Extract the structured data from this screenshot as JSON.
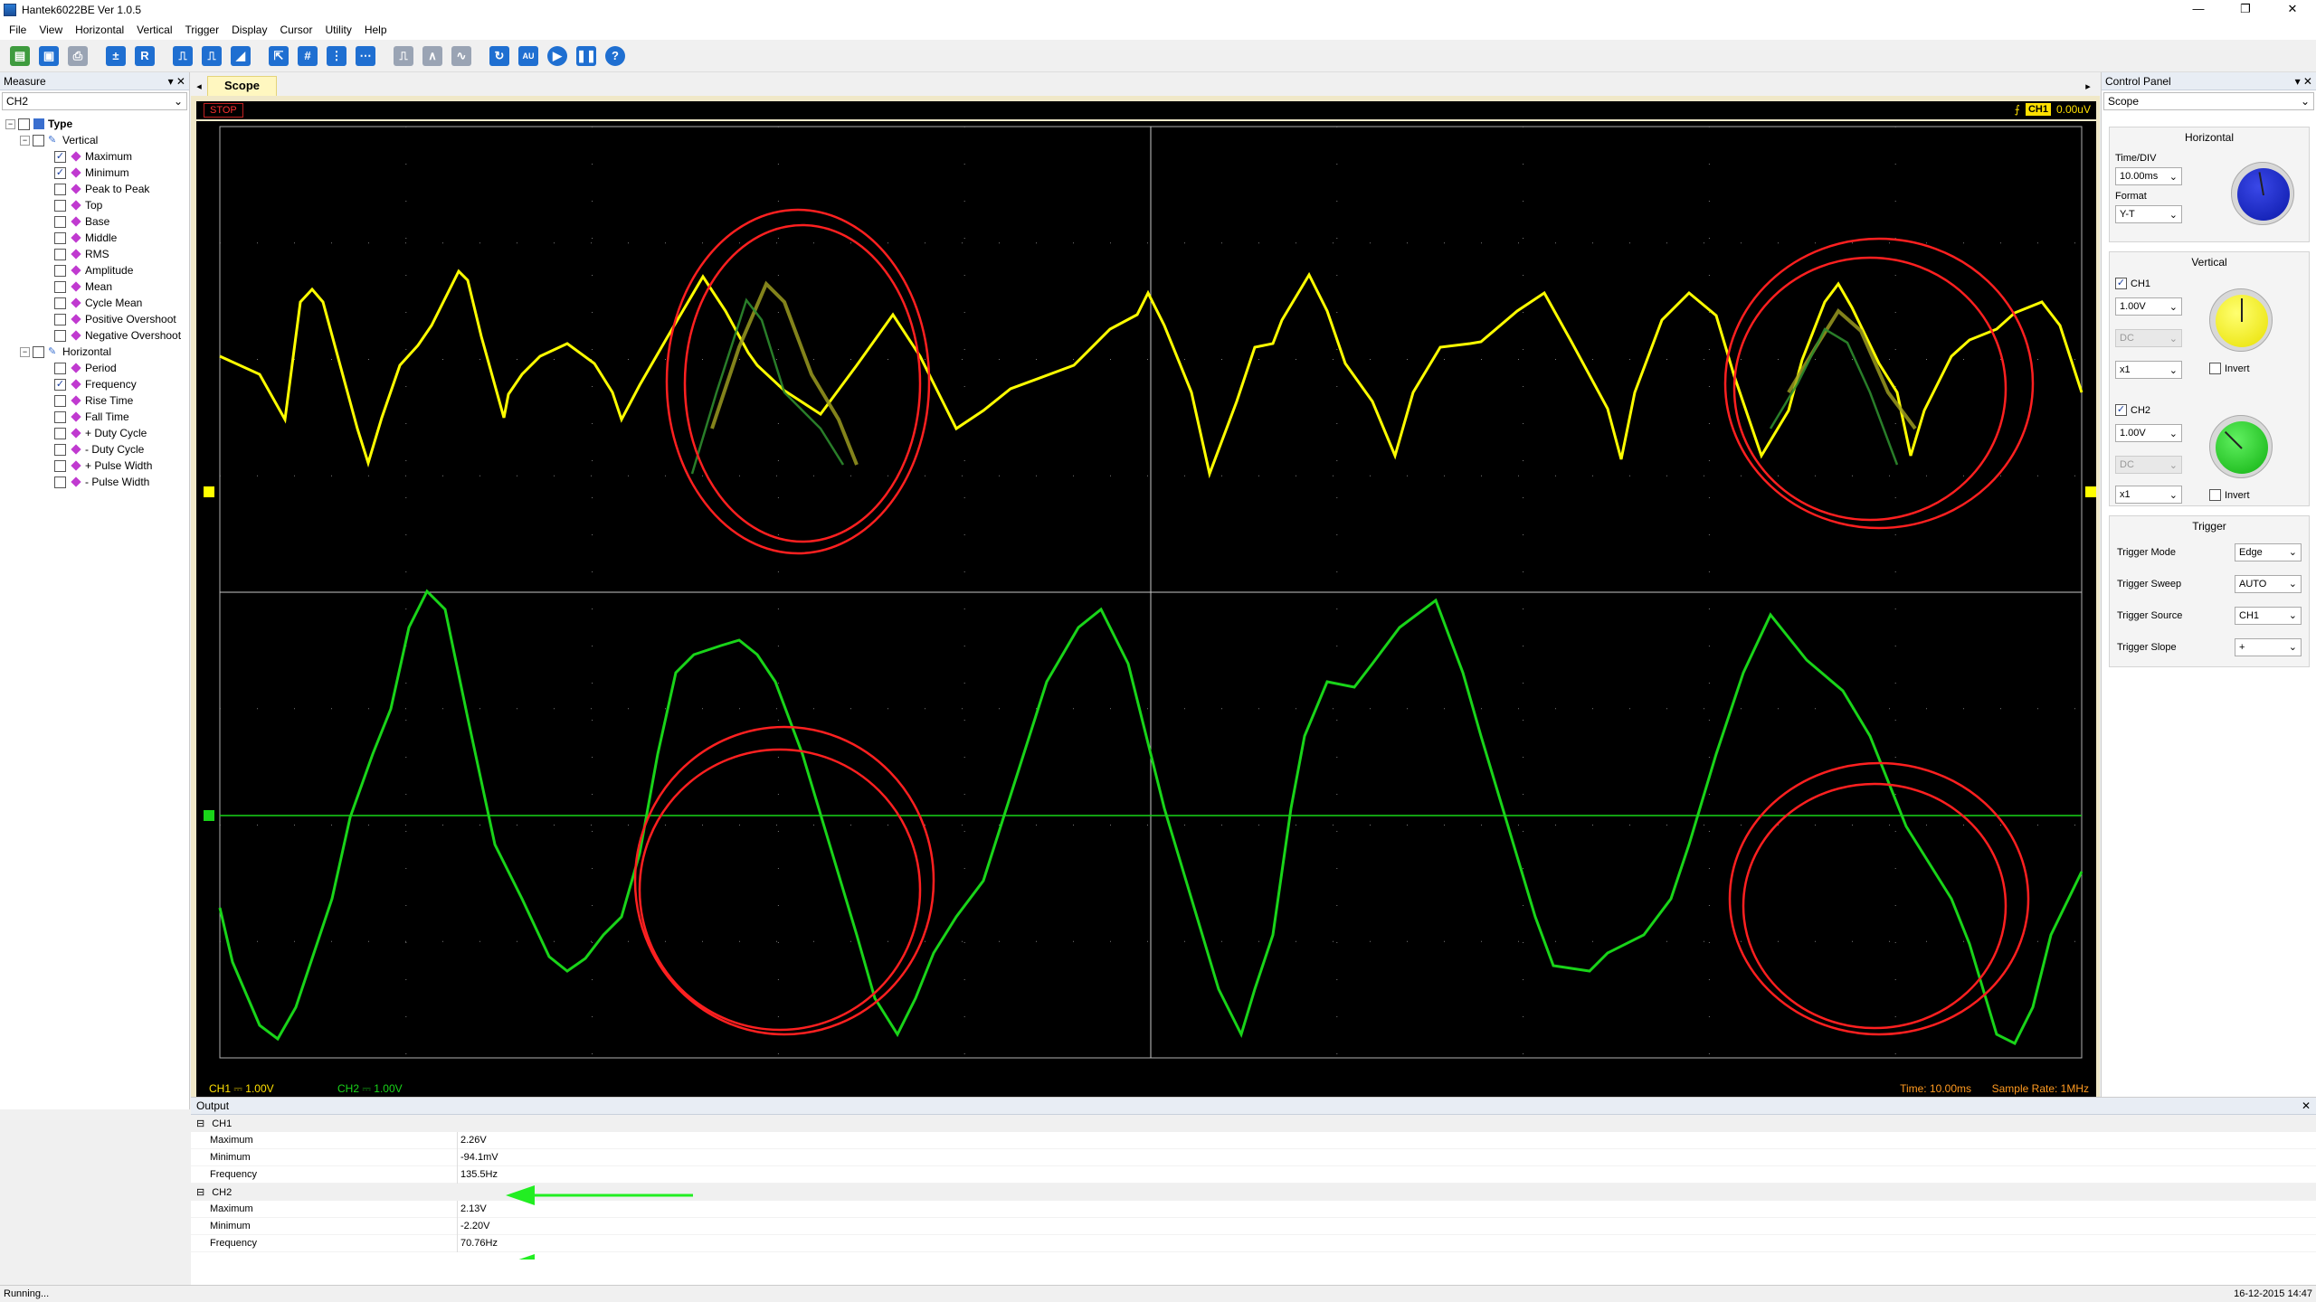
{
  "window": {
    "title": "Hantek6022BE Ver 1.0.5",
    "controls": [
      "—",
      "❐",
      "✕"
    ]
  },
  "menu": [
    "File",
    "View",
    "Horizontal",
    "Vertical",
    "Trigger",
    "Display",
    "Cursor",
    "Utility",
    "Help"
  ],
  "measure_panel": {
    "title": "Measure",
    "pin": "▾ ✕",
    "channel": "CH2",
    "tree": {
      "root": "Type",
      "vertical_label": "Vertical",
      "vertical": [
        {
          "label": "Maximum",
          "checked": true
        },
        {
          "label": "Minimum",
          "checked": true
        },
        {
          "label": "Peak to Peak",
          "checked": false
        },
        {
          "label": "Top",
          "checked": false
        },
        {
          "label": "Base",
          "checked": false
        },
        {
          "label": "Middle",
          "checked": false
        },
        {
          "label": "RMS",
          "checked": false
        },
        {
          "label": "Amplitude",
          "checked": false
        },
        {
          "label": "Mean",
          "checked": false
        },
        {
          "label": "Cycle Mean",
          "checked": false
        },
        {
          "label": "Positive Overshoot",
          "checked": false
        },
        {
          "label": "Negative Overshoot",
          "checked": false
        }
      ],
      "horizontal_label": "Horizontal",
      "horizontal": [
        {
          "label": "Period",
          "checked": false
        },
        {
          "label": "Frequency",
          "checked": true
        },
        {
          "label": "Rise Time",
          "checked": false
        },
        {
          "label": "Fall Time",
          "checked": false
        },
        {
          "label": "+ Duty Cycle",
          "checked": false
        },
        {
          "label": "- Duty Cycle",
          "checked": false
        },
        {
          "label": "+ Pulse Width",
          "checked": false
        },
        {
          "label": "- Pulse Width",
          "checked": false
        }
      ]
    }
  },
  "scope": {
    "tab": "Scope",
    "run_state": "STOP",
    "trigger_channel": "CH1",
    "trigger_level": "0.00uV",
    "ch1_label": "CH1",
    "ch1_scale": "1.00V",
    "ch2_label": "CH2",
    "ch2_scale": "1.00V",
    "time_info": "Time: 10.00ms",
    "sample_rate": "Sample Rate: 1MHz",
    "colors": {
      "ch1": "#ffff00",
      "ch2": "#19d419",
      "annotation": "#ff2020",
      "arrow": "#22ee22"
    }
  },
  "control_panel": {
    "title": "Control Panel",
    "pin": "▾ ✕",
    "mode": "Scope",
    "horizontal": {
      "title": "Horizontal",
      "timediv_label": "Time/DIV",
      "timediv": "10.00ms",
      "format_label": "Format",
      "format": "Y-T"
    },
    "vertical": {
      "title": "Vertical",
      "ch1": {
        "label": "CH1",
        "volt": "1.00V",
        "coupling": "DC",
        "probe": "x1",
        "invert": "Invert"
      },
      "ch2": {
        "label": "CH2",
        "volt": "1.00V",
        "coupling": "DC",
        "probe": "x1",
        "invert": "Invert"
      }
    },
    "trigger": {
      "title": "Trigger",
      "rows": [
        {
          "label": "Trigger Mode",
          "value": "Edge"
        },
        {
          "label": "Trigger Sweep",
          "value": "AUTO"
        },
        {
          "label": "Trigger Source",
          "value": "CH1"
        },
        {
          "label": "Trigger Slope",
          "value": "+"
        }
      ]
    }
  },
  "output": {
    "title": "Output",
    "close": "✕",
    "groups": [
      {
        "name": "CH1",
        "rows": [
          {
            "name": "Maximum",
            "value": "2.26V"
          },
          {
            "name": "Minimum",
            "value": "-94.1mV"
          },
          {
            "name": "Frequency",
            "value": "135.5Hz"
          }
        ]
      },
      {
        "name": "CH2",
        "rows": [
          {
            "name": "Maximum",
            "value": "2.13V"
          },
          {
            "name": "Minimum",
            "value": "-2.20V"
          },
          {
            "name": "Frequency",
            "value": "70.76Hz"
          }
        ]
      }
    ]
  },
  "statusbar": {
    "left": "Running...",
    "right": "16-12-2015  14:47"
  }
}
